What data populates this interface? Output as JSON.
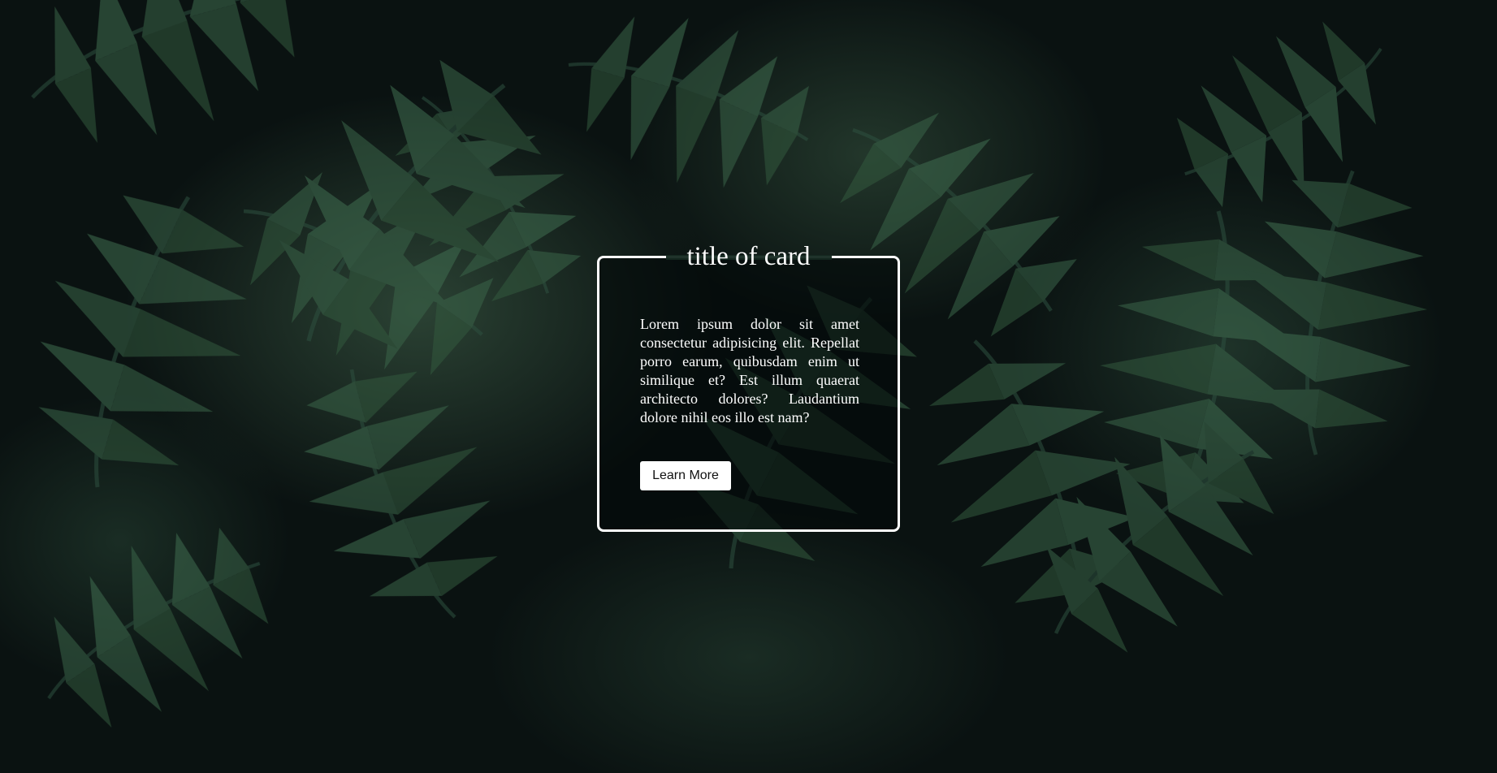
{
  "background": {
    "image_name": "palm-fronds-photo",
    "base_color": "#0a1211",
    "leaf_color": "#3f6a4f"
  },
  "card": {
    "title": "title of card",
    "body": "Lorem ipsum dolor sit amet consectetur adipisicing elit. Repellat porro earum, quibusdam enim ut similique et? Est illum quaerat architecto dolores? Laudantium dolore nihil eos illo est nam?",
    "button_label": "Learn More",
    "border_color": "#ffffff"
  }
}
